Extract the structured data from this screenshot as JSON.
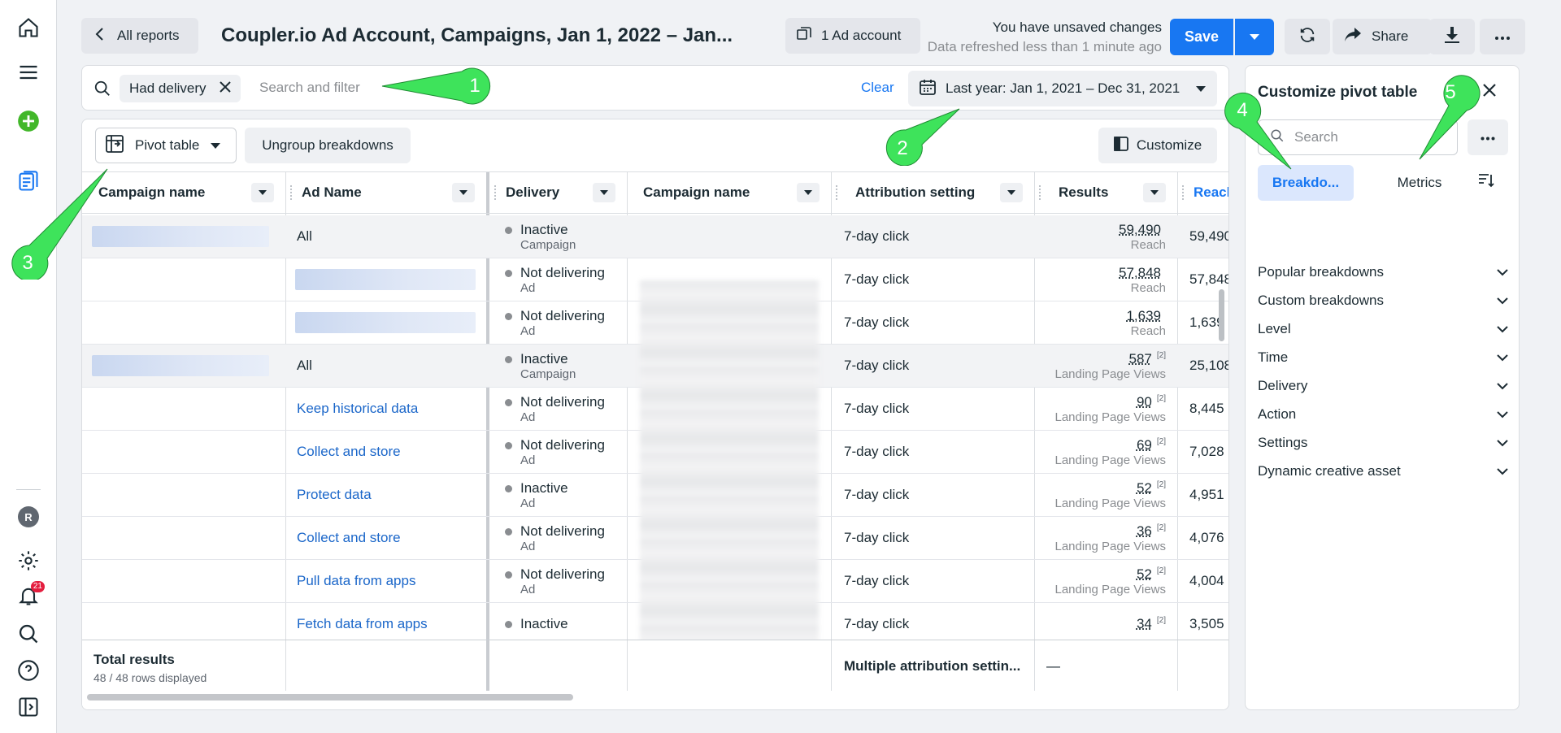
{
  "header": {
    "back_label": "All reports",
    "title": "Coupler.io Ad Account, Campaigns, Jan 1, 2022 – Jan...",
    "ad_account_label": "1 Ad account",
    "unsaved_text": "You have unsaved changes",
    "refresh_text": "Data refreshed less than 1 minute ago",
    "save_label": "Save",
    "share_label": "Share"
  },
  "rail": {
    "notification_count": "21",
    "avatar_initial": "R"
  },
  "filter": {
    "chip_label": "Had delivery",
    "search_placeholder": "Search and filter",
    "clear_label": "Clear",
    "date_range": "Last year: Jan 1, 2021 – Dec 31, 2021"
  },
  "toolbar": {
    "pivot_label": "Pivot table",
    "ungroup_label": "Ungroup breakdowns",
    "customize_label": "Customize"
  },
  "columns": [
    "Campaign name",
    "Ad Name",
    "Delivery",
    "Campaign name",
    "Attribution setting",
    "Results",
    "Reach"
  ],
  "rows": [
    {
      "ad": "All",
      "ad_link": false,
      "delivery": "Inactive",
      "delivery_sub": "Campaign",
      "attribution": "7-day click",
      "result": "59,490",
      "result_note": "",
      "result_unit": "Reach",
      "reach": "59,490",
      "grey": true,
      "campaign_blur": true,
      "ad_blur": false
    },
    {
      "ad": "",
      "ad_link": false,
      "delivery": "Not delivering",
      "delivery_sub": "Ad",
      "attribution": "7-day click",
      "result": "57,848",
      "result_note": "",
      "result_unit": "Reach",
      "reach": "57,848",
      "grey": false,
      "campaign_blur": false,
      "ad_blur": true
    },
    {
      "ad": "",
      "ad_link": false,
      "delivery": "Not delivering",
      "delivery_sub": "Ad",
      "attribution": "7-day click",
      "result": "1,639",
      "result_note": "",
      "result_unit": "Reach",
      "reach": "1,639",
      "grey": false,
      "campaign_blur": false,
      "ad_blur": true
    },
    {
      "ad": "All",
      "ad_link": false,
      "delivery": "Inactive",
      "delivery_sub": "Campaign",
      "attribution": "7-day click",
      "result": "587",
      "result_note": "[2]",
      "result_unit": "Landing Page Views",
      "reach": "25,108",
      "grey": true,
      "campaign_blur": true,
      "ad_blur": false
    },
    {
      "ad": "Keep historical data",
      "ad_link": true,
      "delivery": "Not delivering",
      "delivery_sub": "Ad",
      "attribution": "7-day click",
      "result": "90",
      "result_note": "[2]",
      "result_unit": "Landing Page Views",
      "reach": "8,445",
      "grey": false,
      "campaign_blur": false,
      "ad_blur": false
    },
    {
      "ad": "Collect and store",
      "ad_link": true,
      "delivery": "Not delivering",
      "delivery_sub": "Ad",
      "attribution": "7-day click",
      "result": "69",
      "result_note": "[2]",
      "result_unit": "Landing Page Views",
      "reach": "7,028",
      "grey": false,
      "campaign_blur": false,
      "ad_blur": false
    },
    {
      "ad": "Protect data",
      "ad_link": true,
      "delivery": "Inactive",
      "delivery_sub": "Ad",
      "attribution": "7-day click",
      "result": "52",
      "result_note": "[2]",
      "result_unit": "Landing Page Views",
      "reach": "4,951",
      "grey": false,
      "campaign_blur": false,
      "ad_blur": false
    },
    {
      "ad": "Collect and store",
      "ad_link": true,
      "delivery": "Not delivering",
      "delivery_sub": "Ad",
      "attribution": "7-day click",
      "result": "36",
      "result_note": "[2]",
      "result_unit": "Landing Page Views",
      "reach": "4,076",
      "grey": false,
      "campaign_blur": false,
      "ad_blur": false
    },
    {
      "ad": "Pull data from apps",
      "ad_link": true,
      "delivery": "Not delivering",
      "delivery_sub": "Ad",
      "attribution": "7-day click",
      "result": "52",
      "result_note": "[2]",
      "result_unit": "Landing Page Views",
      "reach": "4,004",
      "grey": false,
      "campaign_blur": false,
      "ad_blur": false
    },
    {
      "ad": "Fetch data from apps",
      "ad_link": true,
      "delivery": "Inactive",
      "delivery_sub": "",
      "attribution": "7-day click",
      "result": "34",
      "result_note": "[2]",
      "result_unit": "",
      "reach": "3,505",
      "grey": false,
      "campaign_blur": false,
      "ad_blur": false
    }
  ],
  "totals": {
    "label": "Total results",
    "rows_displayed": "48 / 48 rows displayed",
    "attribution": "Multiple attribution settin...",
    "result": "—"
  },
  "side_panel": {
    "title": "Customize pivot table",
    "search_placeholder": "Search",
    "tab_breakdowns": "Breakdo...",
    "tab_metrics": "Metrics",
    "sections": [
      "Popular breakdowns",
      "Custom breakdowns",
      "Level",
      "Time",
      "Delivery",
      "Action",
      "Settings",
      "Dynamic creative asset"
    ]
  },
  "callouts": [
    "1",
    "2",
    "3",
    "4",
    "5"
  ],
  "colors": {
    "accent": "#1877f2",
    "callout_green": "#3ee35b",
    "link": "#1a66c9"
  }
}
